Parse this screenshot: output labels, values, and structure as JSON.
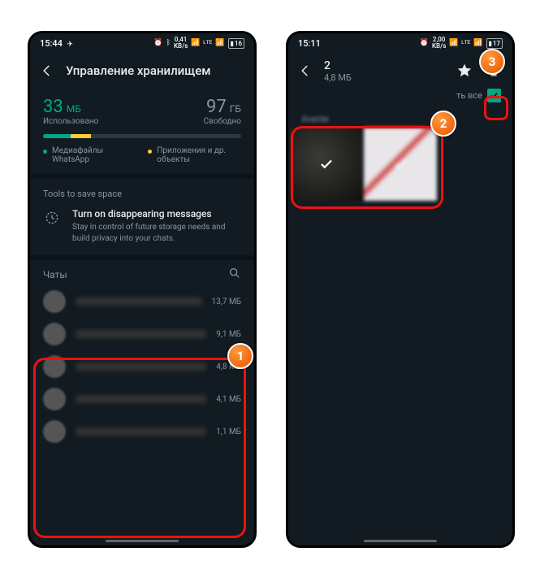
{
  "left": {
    "status": {
      "time": "15:44",
      "net": "0,41",
      "net_unit": "KB/s",
      "batt": "16"
    },
    "header": {
      "title": "Управление хранилищем"
    },
    "storage": {
      "used_val": "33",
      "used_unit": "МБ",
      "used_lbl": "Использовано",
      "free_val": "97",
      "free_unit": "ГБ",
      "free_lbl": "Свободно"
    },
    "legend": {
      "media": "Медиафайлы WhatsApp",
      "apps": "Приложения и др. объекты"
    },
    "tools_title": "Tools to save space",
    "tool": {
      "title": "Turn on disappearing messages",
      "sub": "Stay in control of future storage needs and build privacy into your chats."
    },
    "chats_title": "Чаты",
    "chats": [
      {
        "size": "13,7 МБ"
      },
      {
        "size": "9,1 МБ"
      },
      {
        "size": "4,8 МБ"
      },
      {
        "size": "4,1 МБ"
      },
      {
        "size": "1,1 МБ"
      }
    ]
  },
  "right": {
    "status": {
      "time": "15:11",
      "net": "2,00",
      "net_unit": "KB/s",
      "batt": "17"
    },
    "header": {
      "count": "2",
      "size": "4,8 МБ"
    },
    "selectall": "ть все"
  },
  "badges": {
    "b1": "1",
    "b2": "2",
    "b3": "3"
  }
}
